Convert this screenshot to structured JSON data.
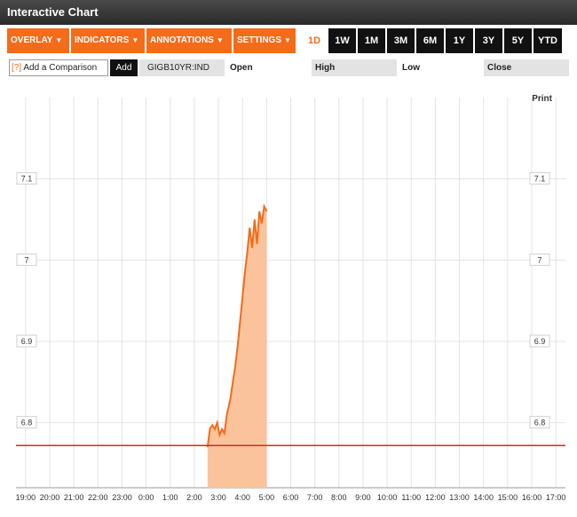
{
  "window": {
    "title": "Interactive Chart"
  },
  "toolbar": {
    "menus": [
      {
        "label": "OVERLAY"
      },
      {
        "label": "INDICATORS"
      },
      {
        "label": "ANNOTATIONS"
      },
      {
        "label": "SETTINGS"
      }
    ],
    "ranges": [
      "1D",
      "1W",
      "1M",
      "3M",
      "6M",
      "1Y",
      "3Y",
      "5Y",
      "YTD"
    ],
    "active_range": "1D"
  },
  "comparison": {
    "help": "[?]",
    "placeholder": "Add a Comparison",
    "add_label": "Add"
  },
  "quote": {
    "symbol": "GIGB10YR:IND",
    "open_label": "Open",
    "high_label": "High",
    "low_label": "Low",
    "close_label": "Close"
  },
  "chart": {
    "print_label": "Print"
  },
  "colors": {
    "accent": "#f46b1a",
    "reference_line": "#e02020",
    "fill": "#fbc39b"
  },
  "chart_data": {
    "type": "area",
    "x_ticks": [
      "19:00",
      "20:00",
      "21:00",
      "22:00",
      "23:00",
      "0:00",
      "1:00",
      "2:00",
      "3:00",
      "4:00",
      "5:00",
      "6:00",
      "7:00",
      "8:00",
      "9:00",
      "10:00",
      "11:00",
      "12:00",
      "13:00",
      "14:00",
      "15:00",
      "16:00",
      "17:00"
    ],
    "y_ticks": [
      "7.1",
      "7",
      "6.9",
      "6.8"
    ],
    "y_tick_values": [
      7.1,
      7.0,
      6.9,
      6.8
    ],
    "ylim": [
      6.72,
      7.2
    ],
    "xlim_hours": [
      18.6,
      41.4
    ],
    "reference_value": 6.772,
    "grid": true,
    "series": [
      {
        "x_hours": [
          26.55,
          26.65,
          26.75,
          26.85,
          26.95,
          27.05,
          27.15,
          27.25,
          27.35,
          27.5,
          27.6,
          27.7,
          27.8,
          27.9,
          28.0,
          28.1,
          28.2,
          28.3,
          28.4,
          28.5,
          28.6,
          28.7,
          28.8,
          28.9,
          29.0
        ],
        "values": [
          6.77,
          6.793,
          6.797,
          6.792,
          6.8,
          6.785,
          6.792,
          6.787,
          6.81,
          6.83,
          6.85,
          6.87,
          6.895,
          6.925,
          6.955,
          6.985,
          7.01,
          7.04,
          7.015,
          7.05,
          7.02,
          7.06,
          7.045,
          7.066,
          7.06
        ]
      }
    ]
  }
}
